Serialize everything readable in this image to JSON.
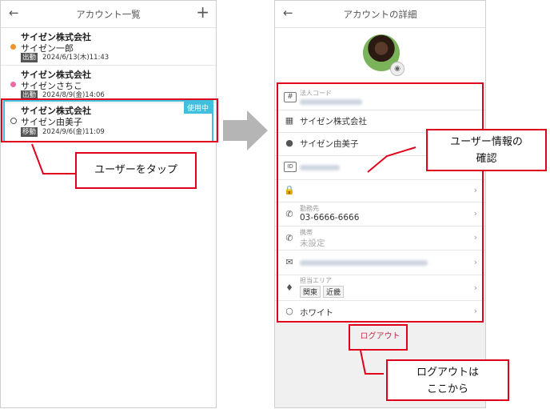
{
  "left_screen": {
    "title": "アカウント一覧",
    "back_icon": "←",
    "add_icon": "+",
    "accounts": [
      {
        "company": "サイゼン株式会社",
        "name": "サイゼン一郎",
        "status": "出勤",
        "date": "2024/6/13(木)11:43",
        "dot_color": "#f0922a"
      },
      {
        "company": "サイゼン株式会社",
        "name": "サイゼンさちこ",
        "status": "出勤",
        "date": "2024/8/9(金)14:06",
        "dot_color": "#ec6aa0"
      },
      {
        "company": "サイゼン株式会社",
        "name": "サイゼン由美子",
        "status": "移動",
        "date": "2024/9/6(金)11:09",
        "badge": "使用中"
      }
    ]
  },
  "right_screen": {
    "title": "アカウントの詳細",
    "back_icon": "←",
    "fields": {
      "corp_code_label": "法人コード",
      "company": "サイゼン株式会社",
      "user_name": "サイゼン由美子",
      "work_phone_label": "勤務先",
      "work_phone": "03-6666-6666",
      "mobile_label": "携帯",
      "mobile": "未設定",
      "area_label": "担当エリア",
      "areas": [
        "関東",
        "近畿"
      ],
      "color": "ホワイト"
    },
    "logout": "ログアウト"
  },
  "annotations": {
    "tap_user": "ユーザーをタップ",
    "confirm_info_1": "ユーザー情報の",
    "confirm_info_2": "確認",
    "logout_here_1": "ログアウトは",
    "logout_here_2": "ここから"
  },
  "colors": {
    "highlight": "#e0001b",
    "active": "#40c0de",
    "logout": "#c0304a",
    "arrow": "#b5b5b5"
  }
}
